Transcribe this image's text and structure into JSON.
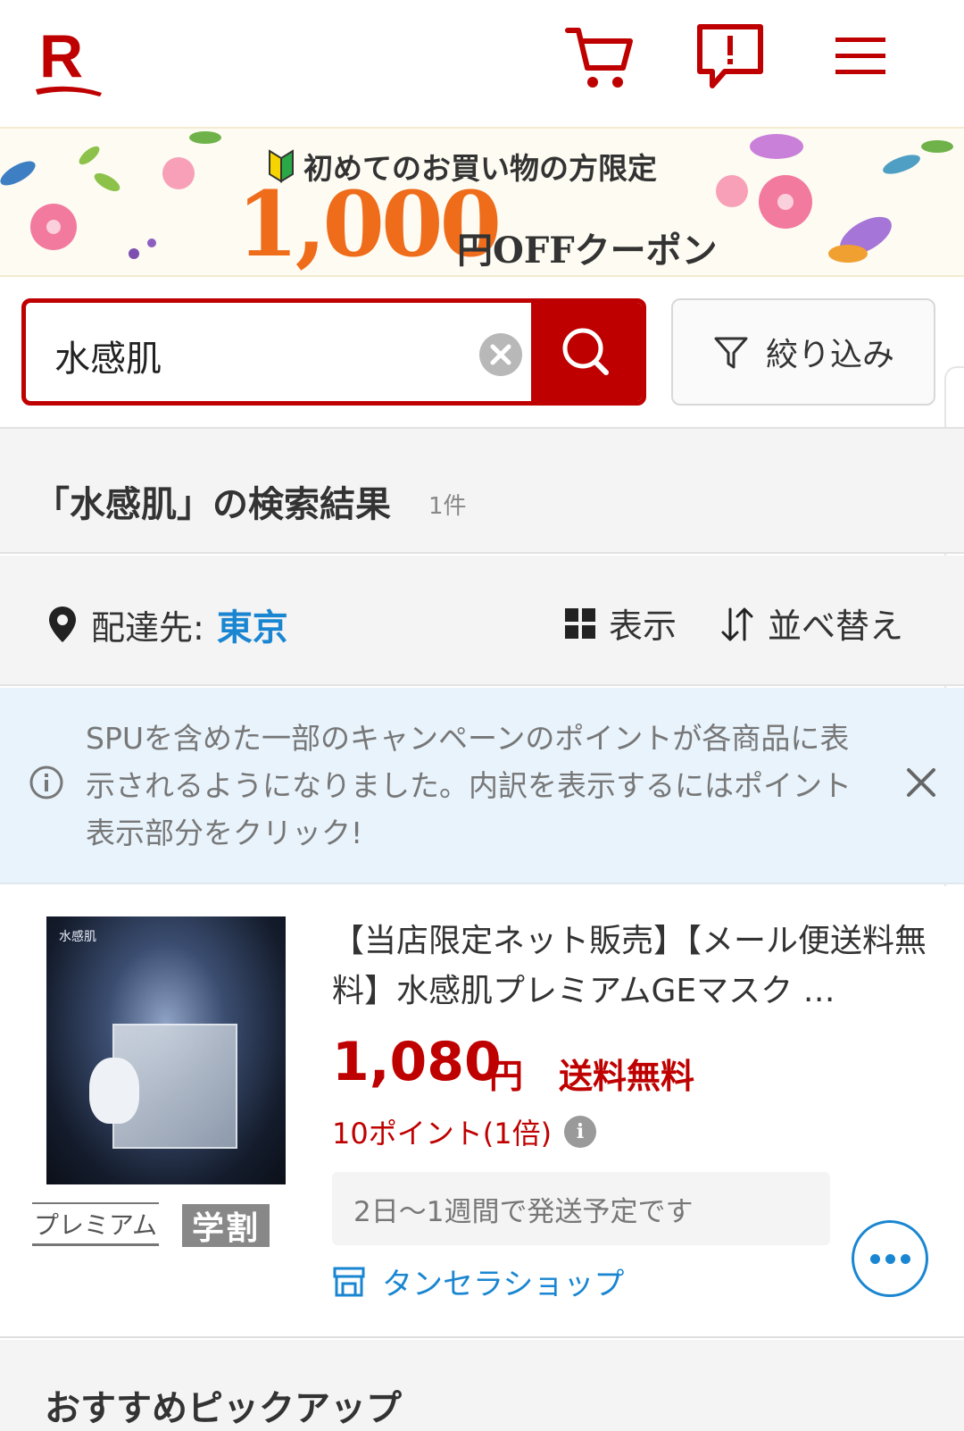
{
  "header": {
    "logo_letter": "R",
    "brand_color": "#bf0000",
    "icons": [
      "cart-icon",
      "feedback-icon",
      "menu-icon"
    ]
  },
  "banner": {
    "line1": "初めてのお買い物の方限定",
    "amount": "1,000",
    "line2": "円OFFクーポン",
    "amount_color": "#ef6c1a"
  },
  "search": {
    "value": "水感肌",
    "filter_label": "絞り込み"
  },
  "results": {
    "title": "「水感肌」の検索結果",
    "count": "1件"
  },
  "toolbar": {
    "delivery_label": "配達先:",
    "delivery_value": "東京",
    "view_label": "表示",
    "sort_label": "並べ替え"
  },
  "notice": {
    "text": "SPUを含めた一部のキャンペーンのポイントが各商品に表示されるようになりました。内訳を表示するにはポイント表示部分をクリック!"
  },
  "product": {
    "image_brand": "水感肌",
    "title": "【当店限定ネット販売】【メール便送料無料】水感肌プレミアムGEマスク …",
    "price": "1,080",
    "currency": "円",
    "shipping": "送料無料",
    "points": "10ポイント(1倍)",
    "delivery": "2日〜1週間で発送予定です",
    "shop": "タンセラショップ",
    "badges": {
      "premium": "プレミアム",
      "student": "学割"
    },
    "accent_color": "#1a86d1"
  },
  "recommended": {
    "title": "おすすめピックアップ"
  }
}
